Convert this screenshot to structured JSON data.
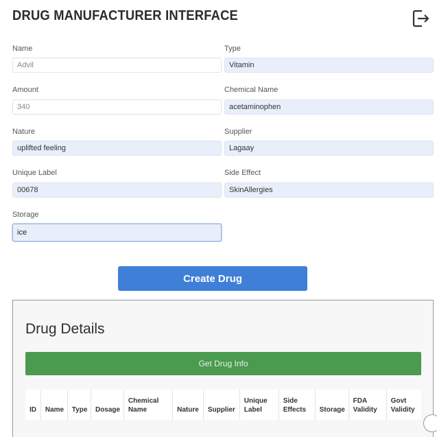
{
  "header": {
    "title": "DRUG MANUFACTURER INTERFACE"
  },
  "form": {
    "name": {
      "label": "Name",
      "value": "Advil"
    },
    "type": {
      "label": "Type",
      "value": "Vitamin"
    },
    "amount": {
      "label": "Amount",
      "value": "340"
    },
    "chemical_name": {
      "label": "Chemical Name",
      "value": "acetaminophen"
    },
    "nature": {
      "label": "Nature",
      "value": "uplifted feeling"
    },
    "supplier": {
      "label": "Supplier",
      "value": "Lagaay"
    },
    "unique_label": {
      "label": "Unique Label",
      "value": "00678"
    },
    "side_effect": {
      "label": "Side Effect",
      "value": "SkinAllergies"
    },
    "storage": {
      "label": "Storage",
      "value": "ice"
    },
    "create_label": "Create Drug"
  },
  "details": {
    "title": "Drug Details",
    "get_info_label": "Get Drug Info",
    "columns": [
      [
        "ID"
      ],
      [
        "Name"
      ],
      [
        "Type"
      ],
      [
        "Dosage"
      ],
      [
        "Chemical",
        "Name"
      ],
      [
        "Nature"
      ],
      [
        "Supplier"
      ],
      [
        "Unique",
        "Label"
      ],
      [
        "Side",
        "Effects"
      ],
      [
        "Storage"
      ],
      [
        "FDA",
        "Validity"
      ],
      [
        "Govt",
        "Validity"
      ]
    ]
  },
  "colors": {
    "primary": "#3f7fd8",
    "success": "#4a9a4f",
    "input_fill": "#e9effa"
  }
}
